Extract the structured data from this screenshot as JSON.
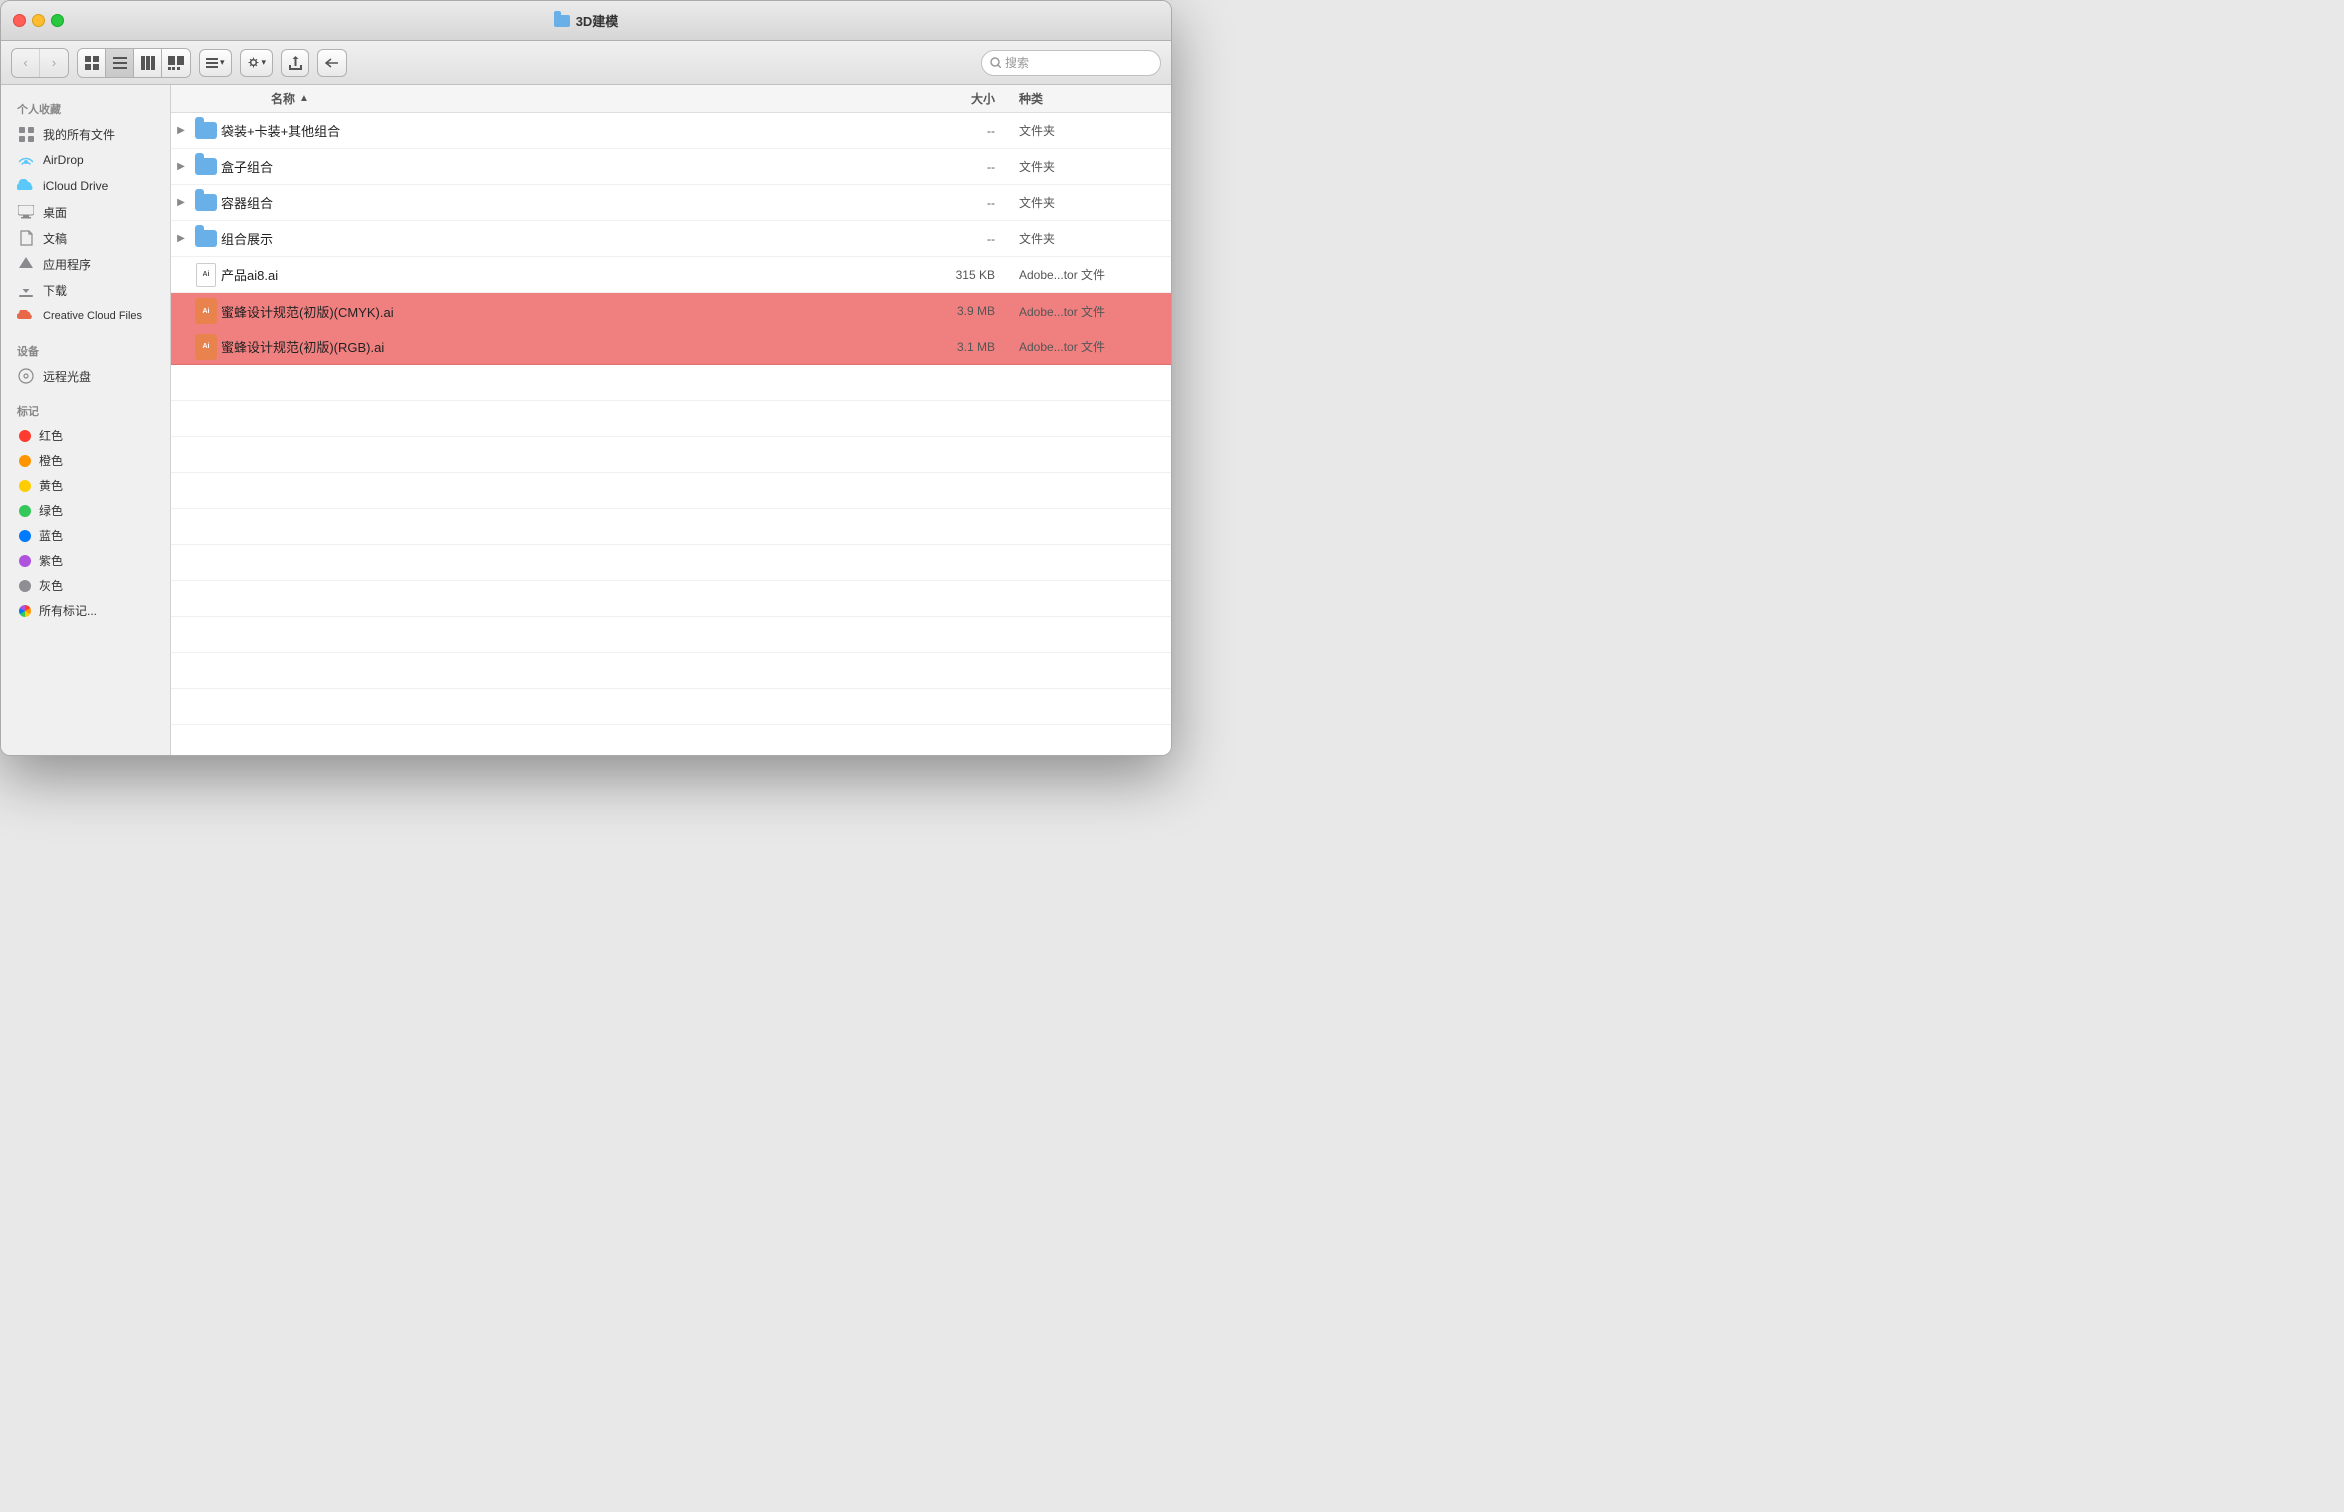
{
  "window": {
    "title": "3D建模",
    "titlebar": {
      "close": "close",
      "minimize": "minimize",
      "maximize": "maximize"
    }
  },
  "toolbar": {
    "back_label": "‹",
    "forward_label": "›",
    "view_icon_label": "⊞",
    "view_list_label": "≡",
    "view_column_label": "⊟",
    "view_cover_label": "⊠",
    "arrange_label": "⊞ ▾",
    "action_label": "⚙ ▾",
    "share_label": "↑",
    "path_label": "⊖",
    "search_placeholder": "搜索"
  },
  "sidebar": {
    "personal_label": "个人收藏",
    "items_personal": [
      {
        "id": "all-files",
        "label": "我的所有文件",
        "icon": "grid"
      },
      {
        "id": "airdrop",
        "label": "AirDrop",
        "icon": "airdrop"
      },
      {
        "id": "icloud",
        "label": "iCloud Drive",
        "icon": "cloud"
      },
      {
        "id": "desktop",
        "label": "桌面",
        "icon": "desktop"
      },
      {
        "id": "documents",
        "label": "文稿",
        "icon": "doc"
      },
      {
        "id": "apps",
        "label": "应用程序",
        "icon": "apps"
      },
      {
        "id": "downloads",
        "label": "下载",
        "icon": "download"
      },
      {
        "id": "creative-cloud",
        "label": "Creative Cloud Files",
        "icon": "cloud2"
      }
    ],
    "devices_label": "设备",
    "items_devices": [
      {
        "id": "optical",
        "label": "远程光盘",
        "icon": "disc"
      }
    ],
    "tags_label": "标记",
    "items_tags": [
      {
        "id": "red",
        "label": "红色",
        "color": "#ff3b30"
      },
      {
        "id": "orange",
        "label": "橙色",
        "color": "#ff9500"
      },
      {
        "id": "yellow",
        "label": "黄色",
        "color": "#ffcc00"
      },
      {
        "id": "green",
        "label": "绿色",
        "color": "#34c759"
      },
      {
        "id": "blue",
        "label": "蓝色",
        "color": "#007aff"
      },
      {
        "id": "purple",
        "label": "紫色",
        "color": "#af52de"
      },
      {
        "id": "gray",
        "label": "灰色",
        "color": "#8e8e93"
      },
      {
        "id": "all-tags",
        "label": "所有标记...",
        "color": ""
      }
    ]
  },
  "file_list": {
    "col_name": "名称",
    "col_size": "大小",
    "col_kind": "种类",
    "rows": [
      {
        "id": "folder1",
        "name": "袋装+卡装+其他组合",
        "type": "folder",
        "size": "--",
        "kind": "文件夹",
        "selected": false,
        "expanded": false
      },
      {
        "id": "folder2",
        "name": "盒子组合",
        "type": "folder",
        "size": "--",
        "kind": "文件夹",
        "selected": false,
        "expanded": false
      },
      {
        "id": "folder3",
        "name": "容器组合",
        "type": "folder",
        "size": "--",
        "kind": "文件夹",
        "selected": false,
        "expanded": false
      },
      {
        "id": "folder4",
        "name": "组合展示",
        "type": "folder",
        "size": "--",
        "kind": "文件夹",
        "selected": false,
        "expanded": false
      },
      {
        "id": "file1",
        "name": "产品ai8.ai",
        "type": "ai-file",
        "size": "315 KB",
        "kind": "Adobe...tor 文件",
        "selected": false,
        "expanded": false
      },
      {
        "id": "file2",
        "name": "蜜蜂设计规范(初版)(CMYK).ai",
        "type": "ai-selected",
        "size": "3.9 MB",
        "kind": "Adobe...tor 文件",
        "selected": true,
        "expanded": false
      },
      {
        "id": "file3",
        "name": "蜜蜂设计规范(初版)(RGB).ai",
        "type": "ai-selected",
        "size": "3.1 MB",
        "kind": "Adobe...tor 文件",
        "selected": true,
        "expanded": false
      }
    ]
  }
}
